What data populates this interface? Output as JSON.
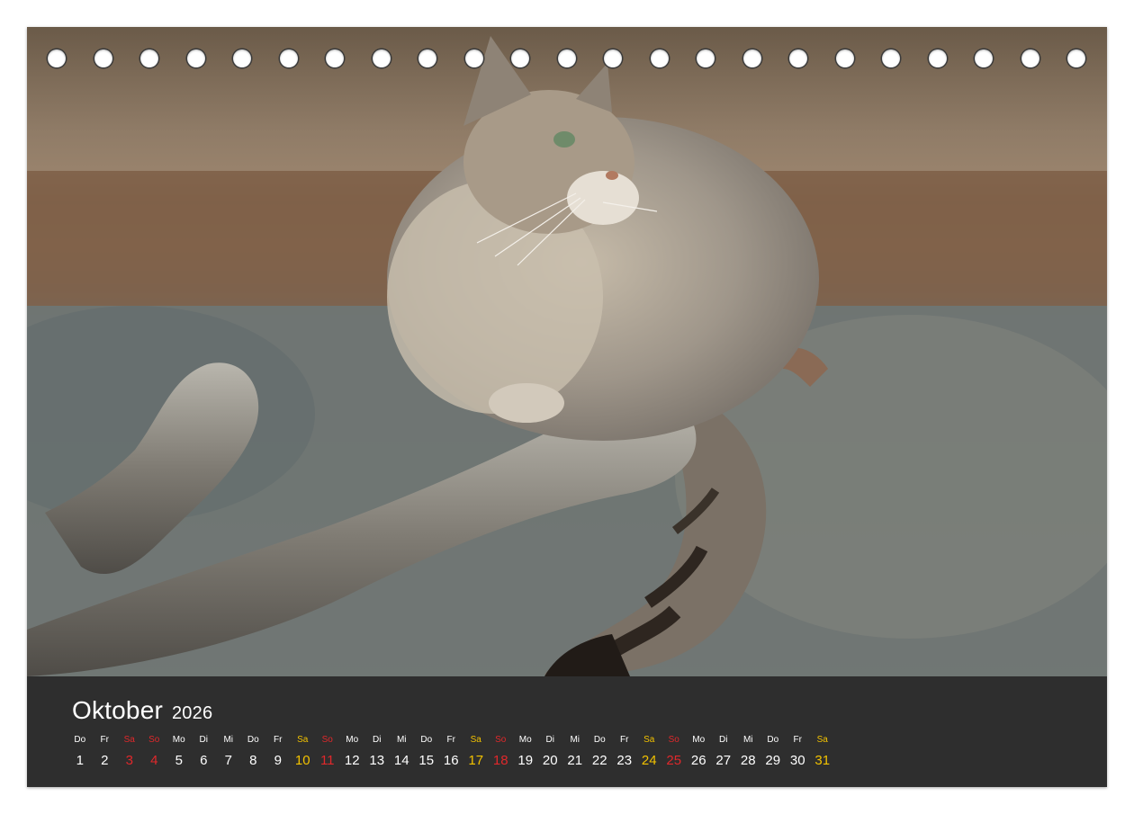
{
  "calendar": {
    "month": "Oktober",
    "year": "2026",
    "days": [
      {
        "wd": "Do",
        "n": "1",
        "type": "weekday"
      },
      {
        "wd": "Fr",
        "n": "2",
        "type": "weekday"
      },
      {
        "wd": "Sa",
        "n": "3",
        "type": "sun"
      },
      {
        "wd": "So",
        "n": "4",
        "type": "sun"
      },
      {
        "wd": "Mo",
        "n": "5",
        "type": "weekday"
      },
      {
        "wd": "Di",
        "n": "6",
        "type": "weekday"
      },
      {
        "wd": "Mi",
        "n": "7",
        "type": "weekday"
      },
      {
        "wd": "Do",
        "n": "8",
        "type": "weekday"
      },
      {
        "wd": "Fr",
        "n": "9",
        "type": "weekday"
      },
      {
        "wd": "Sa",
        "n": "10",
        "type": "sat"
      },
      {
        "wd": "So",
        "n": "11",
        "type": "sun"
      },
      {
        "wd": "Mo",
        "n": "12",
        "type": "weekday"
      },
      {
        "wd": "Di",
        "n": "13",
        "type": "weekday"
      },
      {
        "wd": "Mi",
        "n": "14",
        "type": "weekday"
      },
      {
        "wd": "Do",
        "n": "15",
        "type": "weekday"
      },
      {
        "wd": "Fr",
        "n": "16",
        "type": "weekday"
      },
      {
        "wd": "Sa",
        "n": "17",
        "type": "sat"
      },
      {
        "wd": "So",
        "n": "18",
        "type": "sun"
      },
      {
        "wd": "Mo",
        "n": "19",
        "type": "weekday"
      },
      {
        "wd": "Di",
        "n": "20",
        "type": "weekday"
      },
      {
        "wd": "Mi",
        "n": "21",
        "type": "weekday"
      },
      {
        "wd": "Do",
        "n": "22",
        "type": "weekday"
      },
      {
        "wd": "Fr",
        "n": "23",
        "type": "weekday"
      },
      {
        "wd": "Sa",
        "n": "24",
        "type": "sat"
      },
      {
        "wd": "So",
        "n": "25",
        "type": "sun"
      },
      {
        "wd": "Mo",
        "n": "26",
        "type": "weekday"
      },
      {
        "wd": "Di",
        "n": "27",
        "type": "weekday"
      },
      {
        "wd": "Mi",
        "n": "28",
        "type": "weekday"
      },
      {
        "wd": "Do",
        "n": "29",
        "type": "weekday"
      },
      {
        "wd": "Fr",
        "n": "30",
        "type": "weekday"
      },
      {
        "wd": "Sa",
        "n": "31",
        "type": "sat"
      }
    ]
  },
  "colors": {
    "bar_background": "#2e2e2e",
    "saturday": "#f2c200",
    "sunday": "#e0282b",
    "text": "#ffffff"
  }
}
